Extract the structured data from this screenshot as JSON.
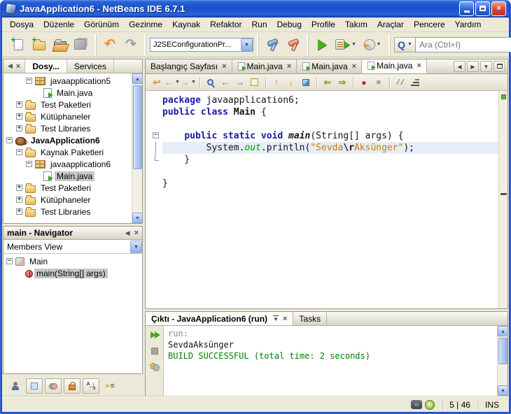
{
  "window": {
    "title": "JavaApplication6 - NetBeans IDE 6.7.1"
  },
  "menu": {
    "items": [
      "Dosya",
      "Düzenle",
      "Görünüm",
      "Gezinme",
      "Kaynak",
      "Refaktor",
      "Run",
      "Debug",
      "Profile",
      "Takım",
      "Araçlar",
      "Pencere",
      "Yardım"
    ]
  },
  "toolbar": {
    "config_value": "J2SEConfigurationPr...",
    "search_placeholder": "Ara (Ctrl+I)",
    "icon_names": [
      "new-file",
      "new-project",
      "open-project",
      "save-all",
      "undo",
      "redo",
      "build",
      "clean-build",
      "run",
      "debug",
      "profile",
      "search"
    ]
  },
  "projects": {
    "tab_files": "Dosy...",
    "tab_services": "Services",
    "tree": [
      {
        "label": "javaapplication5",
        "icon": "package",
        "indent": 2,
        "expand": "minus"
      },
      {
        "label": "Main.java",
        "icon": "javafile",
        "indent": 3,
        "expand": "none"
      },
      {
        "label": "Test Paketleri",
        "icon": "folder",
        "indent": 1,
        "expand": "plus"
      },
      {
        "label": "Kütüphaneler",
        "icon": "folder",
        "indent": 1,
        "expand": "plus"
      },
      {
        "label": "Test Libraries",
        "icon": "folder",
        "indent": 1,
        "expand": "plus"
      },
      {
        "label": "JavaApplication6",
        "icon": "project",
        "indent": 0,
        "expand": "minus",
        "bold": true
      },
      {
        "label": "Kaynak Paketleri",
        "icon": "folder",
        "indent": 1,
        "expand": "minus"
      },
      {
        "label": "javaapplication6",
        "icon": "package",
        "indent": 2,
        "expand": "minus"
      },
      {
        "label": "Main.java",
        "icon": "javafile",
        "indent": 3,
        "expand": "none",
        "selected": true
      },
      {
        "label": "Test Paketleri",
        "icon": "folder",
        "indent": 1,
        "expand": "plus"
      },
      {
        "label": "Kütüphaneler",
        "icon": "folder",
        "indent": 1,
        "expand": "plus"
      },
      {
        "label": "Test Libraries",
        "icon": "folder",
        "indent": 1,
        "expand": "plus"
      }
    ]
  },
  "navigator": {
    "title": "main - Navigator",
    "view": "Members View",
    "tree": [
      {
        "label": "Main",
        "icon": "class",
        "indent": 0,
        "expand": "minus"
      },
      {
        "label": "main(String[] args)",
        "icon": "method",
        "indent": 1,
        "expand": "none",
        "selected": true
      }
    ]
  },
  "editor": {
    "tabs": [
      {
        "label": "Başlangıç Sayfası",
        "java": false
      },
      {
        "label": "Main.java",
        "java": true
      },
      {
        "label": "Main.java",
        "java": true
      },
      {
        "label": "Main.java",
        "java": true
      }
    ],
    "active_tab": 3,
    "code": [
      {
        "tokens": [
          [
            "kw",
            "package"
          ],
          [
            "pl",
            " javaapplication6;"
          ]
        ]
      },
      {
        "tokens": [
          [
            "kw",
            "public"
          ],
          [
            "pl",
            " "
          ],
          [
            "kw",
            "class"
          ],
          [
            "pl",
            " "
          ],
          [
            "cls",
            "Main"
          ],
          [
            "pl",
            " {"
          ]
        ]
      },
      {
        "tokens": []
      },
      {
        "fold": "start",
        "tokens": [
          [
            "pl",
            "    "
          ],
          [
            "kw",
            "public"
          ],
          [
            "pl",
            " "
          ],
          [
            "kw",
            "static"
          ],
          [
            "pl",
            " "
          ],
          [
            "kw",
            "void"
          ],
          [
            "pl",
            " "
          ],
          [
            "mth",
            "main"
          ],
          [
            "pl",
            "(String[] args) {"
          ]
        ]
      },
      {
        "fold": "mid",
        "hl": true,
        "tokens": [
          [
            "pl",
            "        System."
          ],
          [
            "fld",
            "out"
          ],
          [
            "pl",
            ".println("
          ],
          [
            "str",
            "\"Sevda"
          ],
          [
            "esc",
            "\\r"
          ],
          [
            "str",
            "Aksünger\""
          ],
          [
            "pl",
            ");"
          ]
        ]
      },
      {
        "fold": "end",
        "tokens": [
          [
            "pl",
            "    }"
          ]
        ]
      },
      {
        "tokens": []
      },
      {
        "tokens": [
          [
            "pl",
            "}"
          ]
        ]
      }
    ]
  },
  "output": {
    "tab_output": "Çıktı - JavaApplication6 (run)",
    "tab_tasks": "Tasks",
    "lines": [
      {
        "text": "run:",
        "style": "dim"
      },
      {
        "text": "SevdaAksünger",
        "style": "plain"
      },
      {
        "text": "BUILD SUCCESSFUL (total time: 2 seconds)",
        "style": "success"
      }
    ]
  },
  "status": {
    "position": "5 | 46",
    "mode": "INS"
  },
  "icons": {
    "undo": "↶",
    "redo": "↷",
    "caret": "▼",
    "up": "▲",
    "down": "▼",
    "left": "◀",
    "right": "▶",
    "close": "×",
    "minus": "−",
    "plus": "+",
    "last_edit": "↩",
    "arrow_left": "←",
    "arrow_right": "→",
    "arrow_up": "↑",
    "arrow_down": "↓",
    "shift_left": "⇐",
    "shift_right": "⇒",
    "record": "●",
    "stop": "■",
    "comment": "//"
  }
}
